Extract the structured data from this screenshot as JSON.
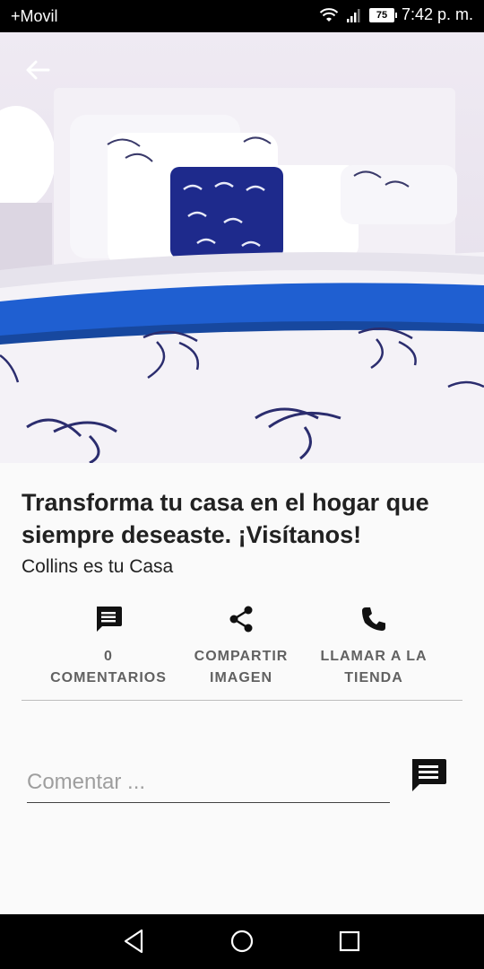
{
  "status_bar": {
    "carrier": "+Movil",
    "battery": "75",
    "time": "7:42 p. m."
  },
  "post": {
    "title": "Transforma tu casa en el hogar que siempre deseaste. ¡Visítanos!",
    "author": "Collins es tu Casa"
  },
  "actions": {
    "comments_count": "0",
    "comments_label": "Comentarios",
    "share_label": "Compartir imagen",
    "call_label": "Llamar a la Tienda"
  },
  "comment_box": {
    "placeholder": "Comentar ..."
  },
  "colors": {
    "accent_blue": "#1f5fd1",
    "navy": "#1e2a8c"
  }
}
